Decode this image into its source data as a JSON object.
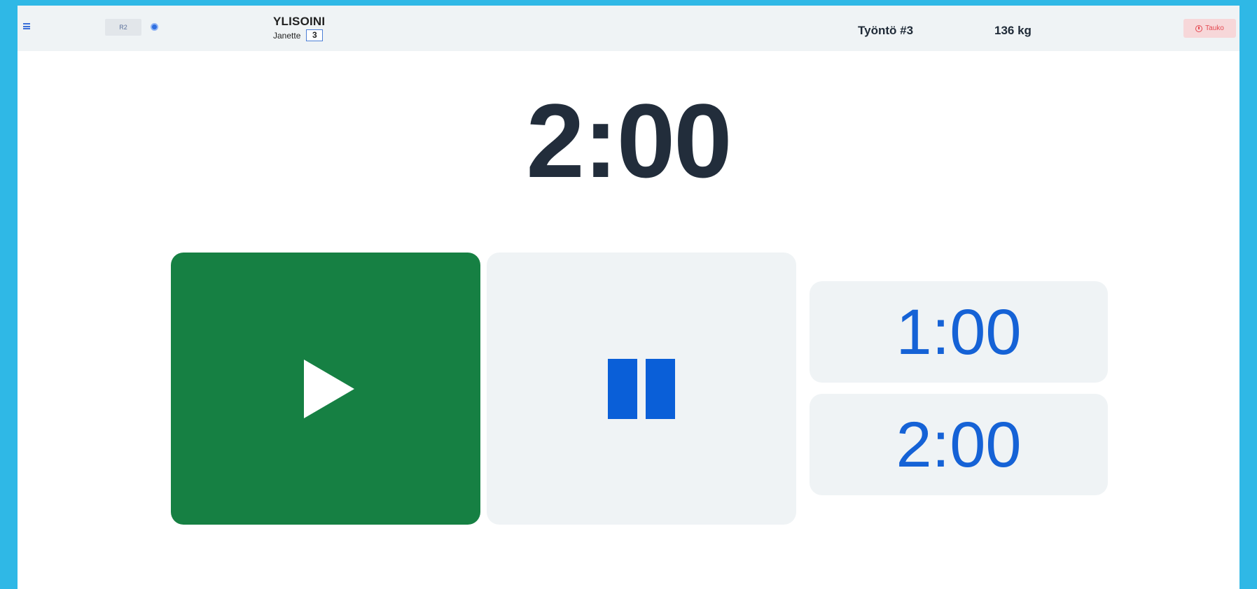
{
  "topbar": {
    "platform": "R2",
    "athlete_last_name": "YLISOINI",
    "athlete_first_name": "Janette",
    "lot_number": "3",
    "attempt": "Työntö #3",
    "weight": "136 kg",
    "break_label": "Tauko"
  },
  "clock": {
    "time": "2:00"
  },
  "controls": {
    "start_icon": "play-icon",
    "pause_icon": "pause-icon",
    "preset_1": "1:00",
    "preset_2": "2:00"
  },
  "colors": {
    "start": "#168043",
    "pause_icon": "#0a5fd8",
    "preset_text": "#1562d6",
    "break": "#e44a52",
    "border": "#2fb8e6"
  }
}
